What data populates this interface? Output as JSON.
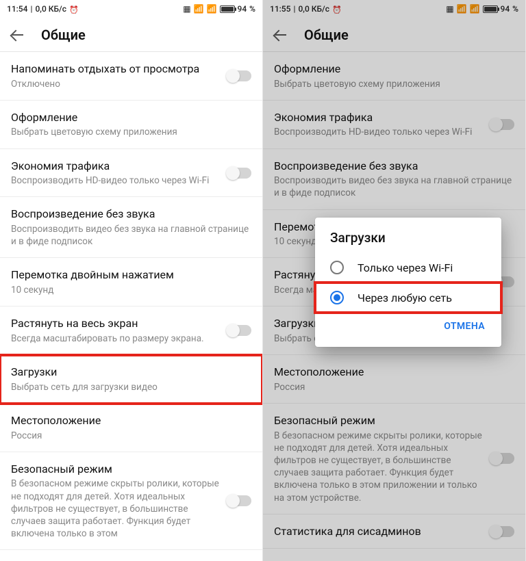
{
  "left": {
    "status": {
      "time": "11:54",
      "net": "0,0 КБ/с",
      "battery_pct": "94"
    },
    "appbar": {
      "title": "Общие"
    },
    "rows": [
      {
        "title": "Напоминать отдыхать от просмотра",
        "sub": "Отключено",
        "toggle": true
      },
      {
        "title": "Оформление",
        "sub": "Выбрать цветовую схему приложения",
        "toggle": false
      },
      {
        "title": "Экономия трафика",
        "sub": "Воспроизводить HD-видео только через Wi-Fi",
        "toggle": true
      },
      {
        "title": "Воспроизведение без звука",
        "sub": "Воспроизводить видео без звука на главной странице и в фиде подписок",
        "toggle": false
      },
      {
        "title": "Перемотка двойным нажатием",
        "sub": "10 секунд",
        "toggle": false
      },
      {
        "title": "Растянуть на весь экран",
        "sub": "Всегда масштабировать по размеру экрана.",
        "toggle": true
      },
      {
        "title": "Загрузки",
        "sub": "Выбрать сеть для загрузки видео",
        "toggle": false,
        "highlight": true
      },
      {
        "title": "Местоположение",
        "sub": "Россия",
        "toggle": false
      },
      {
        "title": "Безопасный режим",
        "sub": "В безопасном режиме скрыты ролики, которые не подходят для детей. Хотя идеальных фильтров не существует, в большинстве случаев защита работает. Функция будет включена только в этом",
        "toggle": true
      }
    ]
  },
  "right": {
    "status": {
      "time": "11:55",
      "net": "0,0 КБ/с",
      "battery_pct": "94"
    },
    "appbar": {
      "title": "Общие"
    },
    "rows": [
      {
        "title": "Оформление",
        "sub": "Выбрать цветовую схему приложения",
        "toggle": false
      },
      {
        "title": "Экономия трафика",
        "sub": "Воспроизводить HD-видео только через Wi-Fi",
        "toggle": true
      },
      {
        "title": "Воспроизведение без звука",
        "sub": "Воспроизводить видео без звука на главной странице и в фиде подписок",
        "toggle": false
      },
      {
        "title": "Перемотка двойным нажатием",
        "sub": "10 секунд",
        "toggle": false
      },
      {
        "title": "Растянуть на весь экран",
        "sub": "Всегда масштабировать по размеру экрана.",
        "toggle": true
      },
      {
        "title": "Загрузки",
        "sub": "Выбрать сеть для загрузки видео",
        "toggle": false
      },
      {
        "title": "Местоположение",
        "sub": "Россия",
        "toggle": false
      },
      {
        "title": "Безопасный режим",
        "sub": "В безопасном режиме скрыты ролики, которые не подходят для детей. Хотя идеальных фильтров не существует, в большинстве случаев защита работает. Функция будет включена только в этом приложении и только на этом устройстве.",
        "toggle": true
      },
      {
        "title": "Статистика для сисадминов",
        "sub": "",
        "toggle": true
      }
    ],
    "dialog": {
      "title": "Загрузки",
      "options": [
        {
          "label": "Только через Wi-Fi",
          "checked": false
        },
        {
          "label": "Через любую сеть",
          "checked": true,
          "highlight": true
        }
      ],
      "cancel": "ОТМЕНА"
    }
  },
  "battery_suffix": "%"
}
